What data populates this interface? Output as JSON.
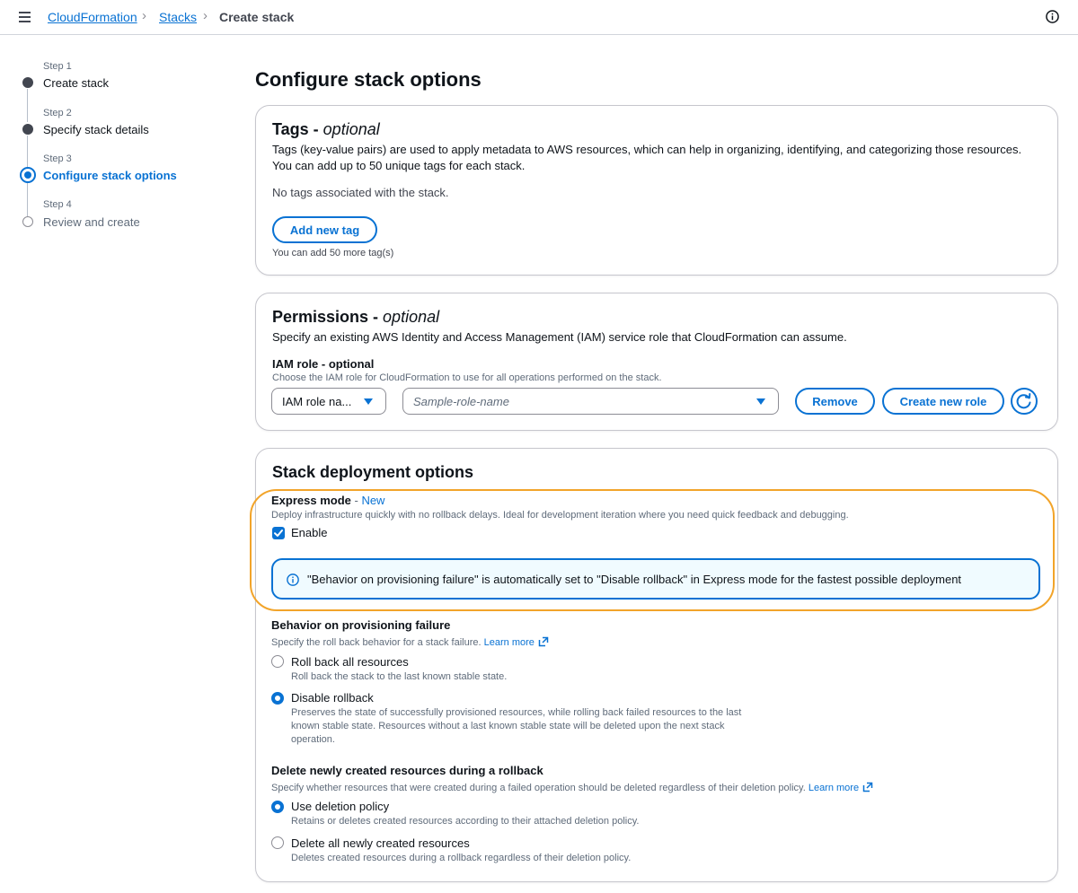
{
  "breadcrumb": {
    "cloudformation": "CloudFormation",
    "stacks": "Stacks",
    "current": "Create stack"
  },
  "steps": [
    {
      "small": "Step 1",
      "label": "Create stack",
      "state": "done"
    },
    {
      "small": "Step 2",
      "label": "Specify stack details",
      "state": "done"
    },
    {
      "small": "Step 3",
      "label": "Configure stack options",
      "state": "active"
    },
    {
      "small": "Step 4",
      "label": "Review and create",
      "state": "future"
    }
  ],
  "page_title": "Configure stack options",
  "tags": {
    "title": "Tags - ",
    "title_optional": "optional",
    "desc_line1": "Tags (key-value pairs) are used to apply metadata to AWS resources, which can help in organizing, identifying, and categorizing those resources.",
    "desc_line2": "You can add up to 50 unique tags for each stack.",
    "empty": "No tags associated with the stack.",
    "add_button": "Add new tag",
    "remaining": "You can add 50 more tag(s)"
  },
  "permissions": {
    "title": "Permissions - ",
    "title_optional": "optional",
    "desc": "Specify an existing AWS Identity and Access Management (IAM) service role that CloudFormation can assume.",
    "iam_label": "IAM role - optional",
    "iam_desc": "Choose the IAM role for CloudFormation to use for all operations performed on the stack.",
    "type_select": "IAM role na...",
    "role_placeholder": "Sample-role-name",
    "remove_button": "Remove",
    "create_button": "Create new role"
  },
  "deployment": {
    "title": "Stack deployment options",
    "express_label": "Express mode",
    "express_dash": " - ",
    "express_new": "New",
    "express_desc": "Deploy infrastructure quickly with no rollback delays. Ideal for development iteration where you need quick feedback and debugging.",
    "enable_label": "Enable",
    "enable_checked": true,
    "alert_text": "\"Behavior on provisioning failure\" is automatically set to \"Disable rollback\" in Express mode for the fastest possible deployment",
    "failure_label": "Behavior on provisioning failure",
    "failure_desc": "Specify the roll back behavior for a stack failure.",
    "learn_more": "Learn more",
    "rollback_all": "Roll back all resources",
    "rollback_all_desc": "Roll back the stack to the last known stable state.",
    "disable_rollback": "Disable rollback",
    "disable_rollback_desc1": "Preserves the state of successfully provisioned resources, while rolling back failed resources to the last",
    "disable_rollback_desc2": "known stable state. Resources without a last known stable state will be deleted upon the next stack",
    "disable_rollback_desc3": "operation.",
    "delete_label": "Delete newly created resources during a rollback",
    "delete_desc": "Specify whether resources that were created during a failed operation should be deleted regardless of their deletion policy.",
    "use_deletion": "Use deletion policy",
    "use_deletion_desc": "Retains or deletes created resources according to their attached deletion policy.",
    "delete_all": "Delete all newly created resources",
    "delete_all_desc": "Deletes created resources during a rollback regardless of their deletion policy."
  },
  "colors": {
    "accent": "#0972d3",
    "highlight": "#f2a42a"
  }
}
